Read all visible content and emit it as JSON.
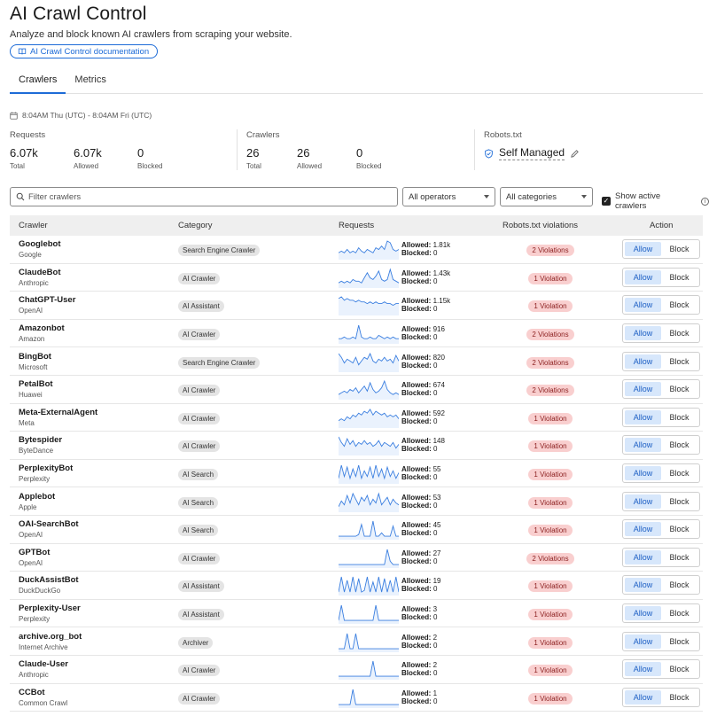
{
  "header": {
    "title": "AI Crawl Control",
    "subtitle": "Analyze and block known AI crawlers from scraping your website.",
    "doc_link": "AI Crawl Control documentation"
  },
  "tabs": [
    {
      "label": "Crawlers",
      "active": true
    },
    {
      "label": "Metrics",
      "active": false
    }
  ],
  "date_range": "8:04AM Thu (UTC) - 8:04AM Fri (UTC)",
  "stats": {
    "requests": {
      "label": "Requests",
      "total": "6.07k",
      "total_label": "Total",
      "allowed": "6.07k",
      "allowed_label": "Allowed",
      "blocked": "0",
      "blocked_label": "Blocked"
    },
    "crawlers": {
      "label": "Crawlers",
      "total": "26",
      "total_label": "Total",
      "allowed": "26",
      "allowed_label": "Allowed",
      "blocked": "0",
      "blocked_label": "Blocked"
    },
    "robots": {
      "label": "Robots.txt",
      "value": "Self Managed"
    }
  },
  "filters": {
    "search_placeholder": "Filter crawlers",
    "operators": "All operators",
    "categories": "All categories",
    "active_label": "Show active crawlers"
  },
  "table": {
    "headers": {
      "crawler": "Crawler",
      "category": "Category",
      "requests": "Requests",
      "violations": "Robots.txt violations",
      "action": "Action"
    },
    "allowed_prefix": "Allowed:",
    "blocked_prefix": "Blocked:",
    "allow_label": "Allow",
    "block_label": "Block",
    "rows": [
      {
        "name": "Googlebot",
        "operator": "Google",
        "category": "Search Engine Crawler",
        "allowed": "1.81k",
        "blocked": "0",
        "violations": "2 Violations",
        "spark": [
          3,
          4,
          3,
          5,
          3,
          4,
          3,
          6,
          4,
          3,
          5,
          4,
          3,
          6,
          5,
          7,
          5,
          10,
          9,
          5,
          4,
          5
        ]
      },
      {
        "name": "ClaudeBot",
        "operator": "Anthropic",
        "category": "AI Crawler",
        "allowed": "1.43k",
        "blocked": "0",
        "violations": "1 Violation",
        "spark": [
          2,
          3,
          2,
          3,
          2,
          4,
          3,
          3,
          2,
          5,
          8,
          5,
          4,
          6,
          9,
          4,
          3,
          4,
          10,
          4,
          3,
          2
        ]
      },
      {
        "name": "ChatGPT-User",
        "operator": "OpenAI",
        "category": "AI Assistant",
        "allowed": "1.15k",
        "blocked": "0",
        "violations": "1 Violation",
        "spark": [
          9,
          10,
          8,
          9,
          8,
          8,
          7,
          8,
          7,
          7,
          6,
          7,
          6,
          7,
          6,
          6,
          7,
          6,
          6,
          5,
          6,
          6
        ]
      },
      {
        "name": "Amazonbot",
        "operator": "Amazon",
        "category": "AI Crawler",
        "allowed": "916",
        "blocked": "0",
        "violations": "2 Violations",
        "spark": [
          2,
          2,
          3,
          2,
          2,
          3,
          2,
          10,
          3,
          2,
          2,
          3,
          2,
          2,
          4,
          3,
          2,
          3,
          2,
          3,
          2,
          2
        ]
      },
      {
        "name": "BingBot",
        "operator": "Microsoft",
        "category": "Search Engine Crawler",
        "allowed": "820",
        "blocked": "0",
        "violations": "2 Violations",
        "spark": [
          9,
          7,
          4,
          6,
          5,
          4,
          7,
          3,
          5,
          7,
          6,
          9,
          5,
          4,
          6,
          5,
          7,
          5,
          6,
          4,
          8,
          5
        ]
      },
      {
        "name": "PetalBot",
        "operator": "Huawei",
        "category": "AI Crawler",
        "allowed": "674",
        "blocked": "0",
        "violations": "2 Violations",
        "spark": [
          2,
          3,
          4,
          3,
          5,
          4,
          6,
          3,
          5,
          7,
          4,
          9,
          5,
          3,
          4,
          6,
          10,
          5,
          3,
          2,
          3,
          2
        ]
      },
      {
        "name": "Meta-ExternalAgent",
        "operator": "Meta",
        "category": "AI Crawler",
        "allowed": "592",
        "blocked": "0",
        "violations": "1 Violation",
        "spark": [
          3,
          4,
          3,
          5,
          4,
          6,
          5,
          7,
          6,
          8,
          7,
          9,
          6,
          8,
          7,
          6,
          7,
          5,
          6,
          5,
          6,
          4
        ]
      },
      {
        "name": "Bytespider",
        "operator": "ByteDance",
        "category": "AI Crawler",
        "allowed": "148",
        "blocked": "0",
        "violations": "1 Violation",
        "spark": [
          9,
          6,
          4,
          8,
          5,
          7,
          4,
          6,
          5,
          7,
          5,
          6,
          4,
          5,
          7,
          4,
          6,
          5,
          4,
          6,
          3,
          5
        ]
      },
      {
        "name": "PerplexityBot",
        "operator": "Perplexity",
        "category": "AI Search",
        "allowed": "55",
        "blocked": "0",
        "violations": "1 Violation",
        "spark": [
          2,
          9,
          3,
          8,
          2,
          7,
          3,
          9,
          2,
          6,
          3,
          8,
          2,
          9,
          3,
          7,
          2,
          8,
          3,
          6,
          2,
          5
        ]
      },
      {
        "name": "Applebot",
        "operator": "Apple",
        "category": "AI Search",
        "allowed": "53",
        "blocked": "0",
        "violations": "1 Violation",
        "spark": [
          2,
          5,
          3,
          8,
          4,
          9,
          6,
          3,
          7,
          5,
          8,
          3,
          6,
          4,
          9,
          3,
          5,
          7,
          3,
          6,
          4,
          3
        ]
      },
      {
        "name": "OAI-SearchBot",
        "operator": "OpenAI",
        "category": "AI Search",
        "allowed": "45",
        "blocked": "0",
        "violations": "1 Violation",
        "spark": [
          1,
          1,
          1,
          1,
          1,
          1,
          1,
          2,
          8,
          1,
          1,
          1,
          10,
          1,
          1,
          3,
          1,
          1,
          1,
          7,
          1,
          1
        ]
      },
      {
        "name": "GPTBot",
        "operator": "OpenAI",
        "category": "AI Crawler",
        "allowed": "27",
        "blocked": "0",
        "violations": "2 Violations",
        "spark": [
          1,
          1,
          1,
          1,
          1,
          1,
          1,
          1,
          1,
          1,
          1,
          1,
          1,
          1,
          1,
          1,
          1,
          10,
          3,
          1,
          1,
          1
        ]
      },
      {
        "name": "DuckAssistBot",
        "operator": "DuckDuckGo",
        "category": "AI Assistant",
        "allowed": "19",
        "blocked": "0",
        "violations": "1 Violation",
        "spark": [
          1,
          10,
          1,
          8,
          1,
          10,
          1,
          9,
          1,
          2,
          10,
          1,
          7,
          1,
          10,
          1,
          9,
          1,
          8,
          1,
          10,
          1
        ]
      },
      {
        "name": "Perplexity-User",
        "operator": "Perplexity",
        "category": "AI Assistant",
        "allowed": "3",
        "blocked": "0",
        "violations": "1 Violation",
        "spark": [
          1,
          10,
          1,
          1,
          1,
          1,
          1,
          1,
          1,
          1,
          1,
          1,
          1,
          10,
          1,
          1,
          1,
          1,
          1,
          1,
          1,
          1
        ]
      },
      {
        "name": "archive.org_bot",
        "operator": "Internet Archive",
        "category": "Archiver",
        "allowed": "2",
        "blocked": "0",
        "violations": "1 Violation",
        "spark": [
          1,
          1,
          1,
          10,
          1,
          1,
          10,
          1,
          1,
          1,
          1,
          1,
          1,
          1,
          1,
          1,
          1,
          1,
          1,
          1,
          1,
          1
        ]
      },
      {
        "name": "Claude-User",
        "operator": "Anthropic",
        "category": "AI Crawler",
        "allowed": "2",
        "blocked": "0",
        "violations": "1 Violation",
        "spark": [
          1,
          1,
          1,
          1,
          1,
          1,
          1,
          1,
          1,
          1,
          1,
          1,
          10,
          1,
          1,
          1,
          1,
          1,
          1,
          1,
          1,
          1
        ]
      },
      {
        "name": "CCBot",
        "operator": "Common Crawl",
        "category": "AI Crawler",
        "allowed": "1",
        "blocked": "0",
        "violations": "1 Violation",
        "spark": [
          1,
          1,
          1,
          1,
          1,
          10,
          1,
          1,
          1,
          1,
          1,
          1,
          1,
          1,
          1,
          1,
          1,
          1,
          1,
          1,
          1,
          1
        ]
      }
    ]
  },
  "colors": {
    "accent": "#1d6bd7",
    "violation_bg": "#f9cfcf",
    "allow_bg": "#d7e7fb"
  }
}
